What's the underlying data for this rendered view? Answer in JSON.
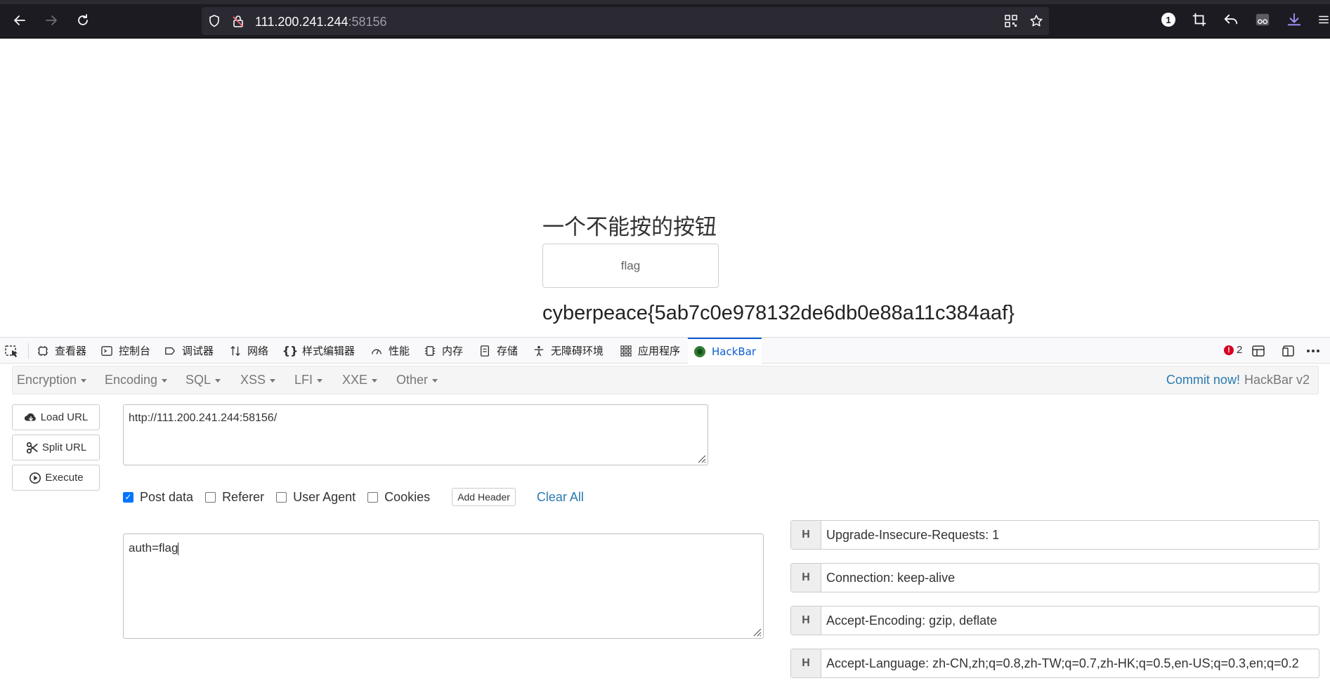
{
  "browser": {
    "url_host": "111.200.241.244",
    "url_port": ":58156",
    "extension_badge": "1"
  },
  "page": {
    "title": "一个不能按的按钮",
    "button_label": "flag",
    "flag_output": "cyberpeace{5ab7c0e978132de6db0e88a11c384aaf}"
  },
  "devtools": {
    "tabs": [
      {
        "label": "查看器",
        "icon": "inspector-icon"
      },
      {
        "label": "控制台",
        "icon": "console-icon"
      },
      {
        "label": "调试器",
        "icon": "debugger-icon"
      },
      {
        "label": "网络",
        "icon": "network-icon"
      },
      {
        "label": "样式编辑器",
        "icon": "style-editor-icon"
      },
      {
        "label": "性能",
        "icon": "performance-icon"
      },
      {
        "label": "内存",
        "icon": "memory-icon"
      },
      {
        "label": "存储",
        "icon": "storage-icon"
      },
      {
        "label": "无障碍环境",
        "icon": "accessibility-icon"
      },
      {
        "label": "应用程序",
        "icon": "application-icon"
      },
      {
        "label": "HackBar",
        "icon": "hackbar-icon"
      }
    ],
    "error_count": "2"
  },
  "hackbar": {
    "menus": [
      "Encryption",
      "Encoding",
      "SQL",
      "XSS",
      "LFI",
      "XXE",
      "Other"
    ],
    "commit_link": "Commit now!",
    "version": "HackBar v2",
    "buttons": {
      "load_url": "Load URL",
      "split_url": "Split URL",
      "execute": "Execute"
    },
    "url_value": "http://111.200.241.244:58156/",
    "options": {
      "post_data": "Post data",
      "referer": "Referer",
      "user_agent": "User Agent",
      "cookies": "Cookies",
      "add_header": "Add Header",
      "clear_all": "Clear All"
    },
    "post_body": "auth=flag",
    "header_tag": "H",
    "headers": [
      "Upgrade-Insecure-Requests: 1",
      "Connection: keep-alive",
      "Accept-Encoding: gzip, deflate",
      "Accept-Language: zh-CN,zh;q=0.8,zh-TW;q=0.7,zh-HK;q=0.5,en-US;q=0.3,en;q=0.2"
    ]
  }
}
